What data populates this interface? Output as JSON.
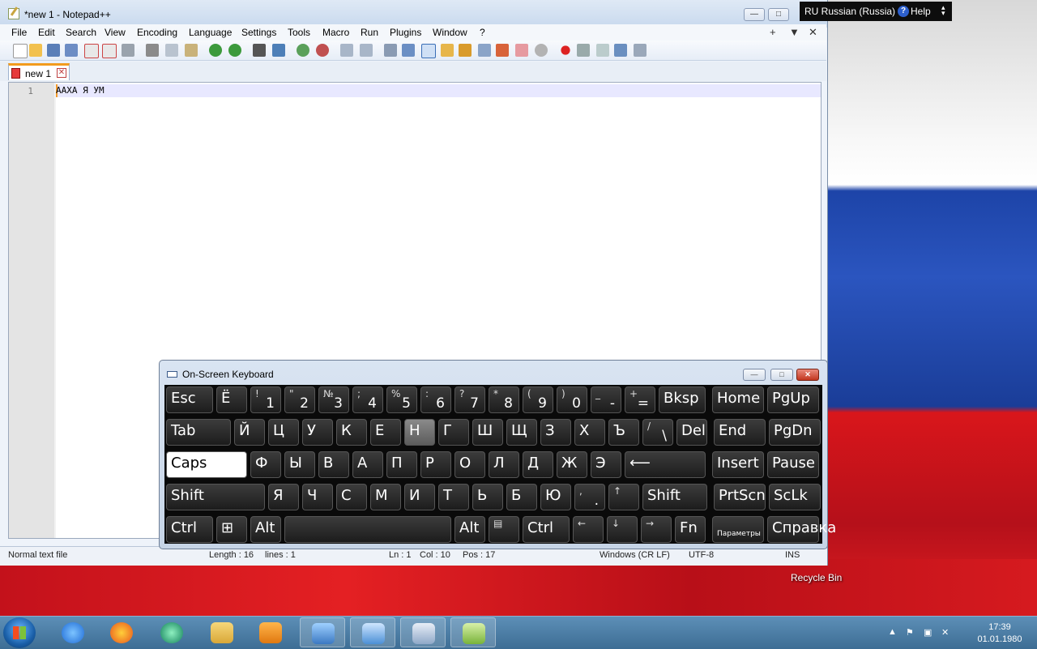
{
  "notepad": {
    "title": "*new 1 - Notepad++",
    "menu": [
      "File",
      "Edit",
      "Search",
      "View",
      "Encoding",
      "Language",
      "Settings",
      "Tools",
      "Macro",
      "Run",
      "Plugins",
      "Window",
      "?"
    ],
    "menu_right": [
      "+",
      "▼",
      "✕"
    ],
    "tab_label": "new 1",
    "line_number": "1",
    "code_line": "ААХА Я УМ",
    "status": {
      "file_type": "Normal text file",
      "length": "Length : 16",
      "lines": "lines : 1",
      "ln": "Ln : 1",
      "col": "Col : 10",
      "pos": "Pos : 17",
      "eol": "Windows (CR LF)",
      "encoding": "UTF-8",
      "mode": "INS"
    }
  },
  "langbar": {
    "language": "RU Russian (Russia)",
    "help": "Help",
    "help_icon": "?"
  },
  "desktop": {
    "recycle_bin": "Recycle Bin"
  },
  "osk": {
    "title": "On-Screen Keyboard",
    "rows": [
      [
        {
          "m": "Esc"
        },
        {
          "m": "Ё"
        },
        {
          "s": "!",
          "b": "1"
        },
        {
          "s": "\"",
          "b": "2"
        },
        {
          "s": "№",
          "b": "3"
        },
        {
          "s": ";",
          "b": "4"
        },
        {
          "s": "%",
          "b": "5"
        },
        {
          "s": ":",
          "b": "6"
        },
        {
          "s": "?",
          "b": "7"
        },
        {
          "s": "*",
          "b": "8"
        },
        {
          "s": "(",
          "b": "9"
        },
        {
          "s": ")",
          "b": "0"
        },
        {
          "s": "_",
          "b": "-"
        },
        {
          "s": "+",
          "b": "="
        },
        {
          "m": "Bksp"
        },
        {
          "m": "Home"
        },
        {
          "m": "PgUp"
        }
      ],
      [
        {
          "m": "Tab"
        },
        {
          "m": "Й"
        },
        {
          "m": "Ц"
        },
        {
          "m": "У"
        },
        {
          "m": "К"
        },
        {
          "m": "Е"
        },
        {
          "m": "Н"
        },
        {
          "m": "Г"
        },
        {
          "m": "Ш"
        },
        {
          "m": "Щ"
        },
        {
          "m": "З"
        },
        {
          "m": "Х"
        },
        {
          "m": "Ъ"
        },
        {
          "s": "/",
          "b": "\\"
        },
        {
          "m": "Del"
        },
        {
          "m": "End"
        },
        {
          "m": "PgDn"
        }
      ],
      [
        {
          "m": "Caps"
        },
        {
          "m": "Ф"
        },
        {
          "m": "Ы"
        },
        {
          "m": "В"
        },
        {
          "m": "А"
        },
        {
          "m": "П"
        },
        {
          "m": "Р"
        },
        {
          "m": "О"
        },
        {
          "m": "Л"
        },
        {
          "m": "Д"
        },
        {
          "m": "Ж"
        },
        {
          "m": "Э"
        },
        {
          "m": "⟵"
        },
        {
          "m": "Insert"
        },
        {
          "m": "Pause"
        }
      ],
      [
        {
          "m": "Shift"
        },
        {
          "m": "Я"
        },
        {
          "m": "Ч"
        },
        {
          "m": "С"
        },
        {
          "m": "М"
        },
        {
          "m": "И"
        },
        {
          "m": "Т"
        },
        {
          "m": "Ь"
        },
        {
          "m": "Б"
        },
        {
          "m": "Ю"
        },
        {
          "s": ",",
          "b": "."
        },
        {
          "s": "↑"
        },
        {
          "m": "Shift"
        },
        {
          "m": "PrtScn"
        },
        {
          "m": "ScLk"
        }
      ],
      [
        {
          "m": "Ctrl"
        },
        {
          "m": "⊞"
        },
        {
          "m": "Alt"
        },
        {
          "m": ""
        },
        {
          "m": "Alt"
        },
        {
          "s": "▤"
        },
        {
          "m": "Ctrl"
        },
        {
          "s": "←"
        },
        {
          "s": "↓"
        },
        {
          "s": "→"
        },
        {
          "m": "Fn"
        },
        {
          "m": "Параметры"
        },
        {
          "m": "Справка"
        }
      ]
    ]
  },
  "taskbar": {
    "time": "17:39",
    "date": "01.01.1980",
    "apps": [
      "start-orb",
      "internet-explorer",
      "firefox",
      "chat-app",
      "file-explorer",
      "media-player",
      "photo-viewer",
      "control-panel",
      "on-screen-keyboard",
      "notepad-plus-plus"
    ]
  },
  "colors": {
    "accent": "#f39a2b",
    "keyboard_bg": "#0a0a0a",
    "flag_white": "#ffffff",
    "flag_blue": "#1a3f9e",
    "flag_red": "#d61a1f"
  }
}
